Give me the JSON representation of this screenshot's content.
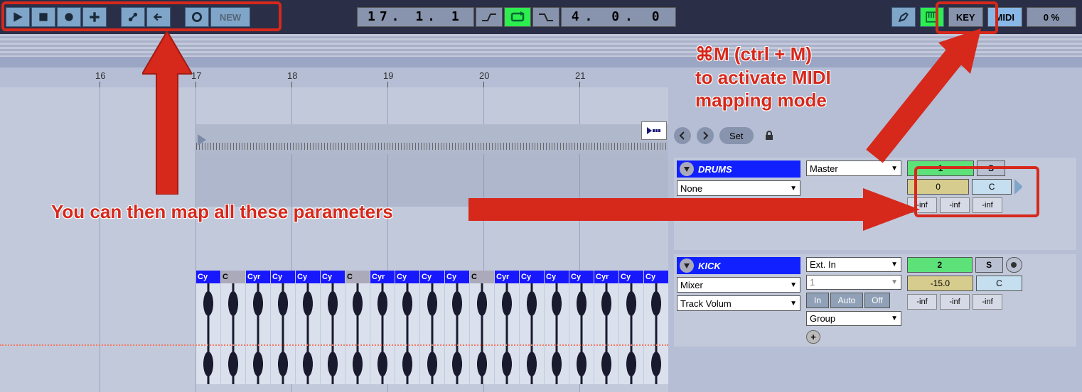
{
  "transport": {
    "new_label": "NEW",
    "position": "17.  1.  1",
    "tempo_or_sig": "4.  0.  0",
    "key_label": "KEY",
    "midi_label": "MIDI",
    "cpu": "0 %"
  },
  "ruler": {
    "numbers": [
      "16",
      "17",
      "18",
      "19",
      "20",
      "21"
    ]
  },
  "header_row": {
    "set_label": "Set"
  },
  "clip_labels": [
    "Cy",
    "C",
    "Cyr",
    "Cy",
    "Cy",
    "Cy",
    "C",
    "Cyr",
    "Cy",
    "Cy",
    "Cy",
    "C",
    "Cyr",
    "Cy",
    "Cy",
    "Cy",
    "Cyr",
    "Cy",
    "Cy"
  ],
  "tracks": {
    "drums": {
      "name": "DRUMS",
      "route_primary": "Master",
      "route_none": "None",
      "activator": "1",
      "send_a": "0",
      "solo": "S",
      "pan": "C",
      "inf": "-inf"
    },
    "kick": {
      "name": "KICK",
      "route_primary": "Ext. In",
      "route_secondary": "Mixer",
      "route_tertiary": "Track Volum",
      "channel": "1",
      "group": "Group",
      "activator": "2",
      "send_a": "-15.0",
      "solo": "S",
      "pan": "C",
      "in": "In",
      "auto": "Auto",
      "off": "Off",
      "inf": "-inf"
    }
  },
  "annotations": {
    "topright_line1": "⌘M (ctrl + M)",
    "topright_line2": "to activate MIDI",
    "topright_line3": "mapping mode",
    "center": "You can then map all these parameters"
  }
}
